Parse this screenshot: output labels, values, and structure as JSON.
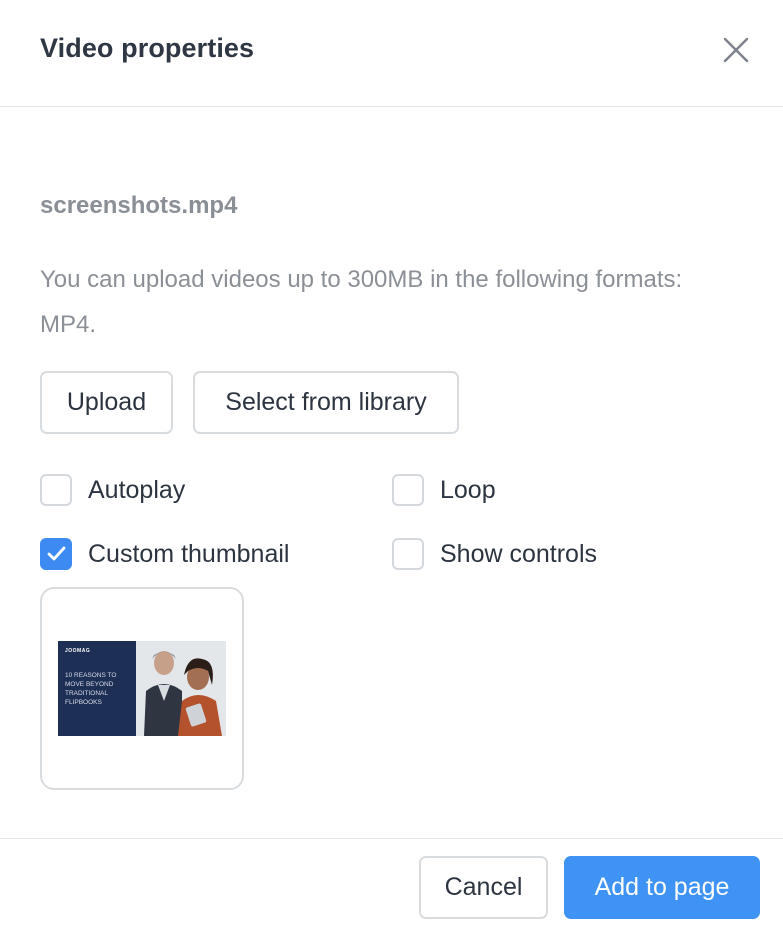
{
  "dialog": {
    "title": "Video properties",
    "close_icon": "close-icon"
  },
  "file": {
    "name": "screenshots.mp4",
    "help_text": "You can upload videos up to 300MB in the following formats: MP4."
  },
  "actions": {
    "upload_label": "Upload",
    "library_label": "Select from library"
  },
  "options": {
    "autoplay": {
      "label": "Autoplay",
      "checked": false
    },
    "loop": {
      "label": "Loop",
      "checked": false
    },
    "custom_thumbnail": {
      "label": "Custom thumbnail",
      "checked": true
    },
    "show_controls": {
      "label": "Show controls",
      "checked": false
    }
  },
  "thumbnail": {
    "brand": "JOOMAG",
    "headline": "10 REASONS TO MOVE BEYOND TRADITIONAL FLIPBOOKS"
  },
  "footer": {
    "cancel_label": "Cancel",
    "add_label": "Add to page"
  },
  "colors": {
    "accent": "#3f93f5",
    "checkbox_on": "#3d8bf2",
    "muted_text": "#8b8f96"
  }
}
